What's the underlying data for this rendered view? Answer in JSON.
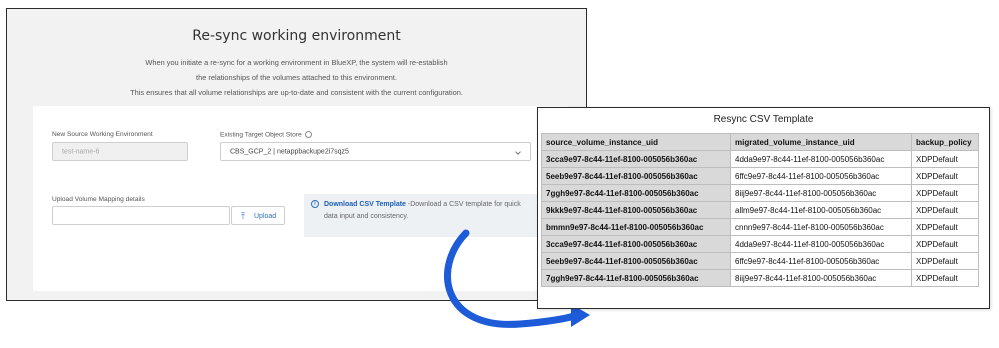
{
  "dialog": {
    "title": "Re-sync working environment",
    "description": [
      "When you initiate a re-sync for a working environment in BlueXP, the system will re-establish",
      "the relationships of the volumes attached to this environment.",
      "This ensures that all volume relationships are up-to-date and consistent with the current configuration."
    ]
  },
  "form": {
    "source_label": "New Source Working Environment",
    "source_value": "test-name-6",
    "target_label": "Existing Target Object Store",
    "target_value": "CBS_GCP_2 | netappbackupe2i7sqz5",
    "upload_label": "Upload Volume Mapping details",
    "upload_value": "",
    "upload_button": "Upload",
    "info_link": "Download CSV Template",
    "info_text": " -Download a CSV template for quick data input and consistency."
  },
  "csv_popup": {
    "title": "Resync CSV Template",
    "columns": [
      "source_volume_instance_uid",
      "migrated_volume_instance_uid",
      "backup_policy"
    ],
    "rows": [
      [
        "3cca9e97-8c44-11ef-8100-005056b360ac",
        "4dda9e97-8c44-11ef-8100-005056b360ac",
        "XDPDefault"
      ],
      [
        "5eeb9e97-8c44-11ef-8100-005056b360ac",
        "6ffc9e97-8c44-11ef-8100-005056b360ac",
        "XDPDefault"
      ],
      [
        "7ggh9e97-8c44-11ef-8100-005056b360ac",
        "8iij9e97-8c44-11ef-8100-005056b360ac",
        "XDPDefault"
      ],
      [
        "9kkk9e97-8c44-11ef-8100-005056b360ac",
        "allm9e97-8c44-11ef-8100-005056b360ac",
        "XDPDefault"
      ],
      [
        "bmmn9e97-8c44-11ef-8100-005056b360ac",
        "cnnn9e97-8c44-11ef-8100-005056b360ac",
        "XDPDefault"
      ],
      [
        "3cca9e97-8c44-11ef-8100-005056b360ac",
        "4dda9e97-8c44-11ef-8100-005056b360ac",
        "XDPDefault"
      ],
      [
        "5eeb9e97-8c44-11ef-8100-005056b360ac",
        "6ffc9e97-8c44-11ef-8100-005056b360ac",
        "XDPDefault"
      ],
      [
        "7ggh9e97-8c44-11ef-8100-005056b360ac",
        "8iij9e97-8c44-11ef-8100-005056b360ac",
        "XDPDefault"
      ]
    ]
  },
  "colors": {
    "arrow": "#1e5bd8",
    "link": "#1a5fb4",
    "header_gray": "#d9d9d9"
  },
  "icons": [
    "info-icon",
    "upload-icon",
    "chevron-down-icon",
    "curved-arrow-icon"
  ]
}
